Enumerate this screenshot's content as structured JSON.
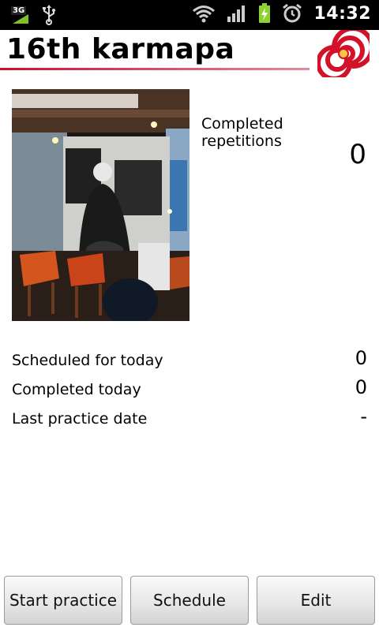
{
  "status_bar": {
    "network_label": "3G",
    "time": "14:32",
    "icons": [
      "3g-signal-icon",
      "usb-icon",
      "wifi-icon",
      "cell-signal-icon",
      "battery-charging-icon",
      "alarm-clock-icon"
    ]
  },
  "header": {
    "title": "16th karmapa",
    "logo": "spiral-logo-icon",
    "accent_color": "#c8102e"
  },
  "practice": {
    "image": "practice-photo",
    "completed_label": "Completed repetitions",
    "completed_value": "0"
  },
  "stats": [
    {
      "label": "Scheduled for today",
      "value": "0"
    },
    {
      "label": "Completed today",
      "value": "0"
    },
    {
      "label": "Last practice date",
      "value": "-"
    }
  ],
  "buttons": {
    "start_label": "Start practice",
    "schedule_label": "Schedule",
    "edit_label": "Edit"
  }
}
